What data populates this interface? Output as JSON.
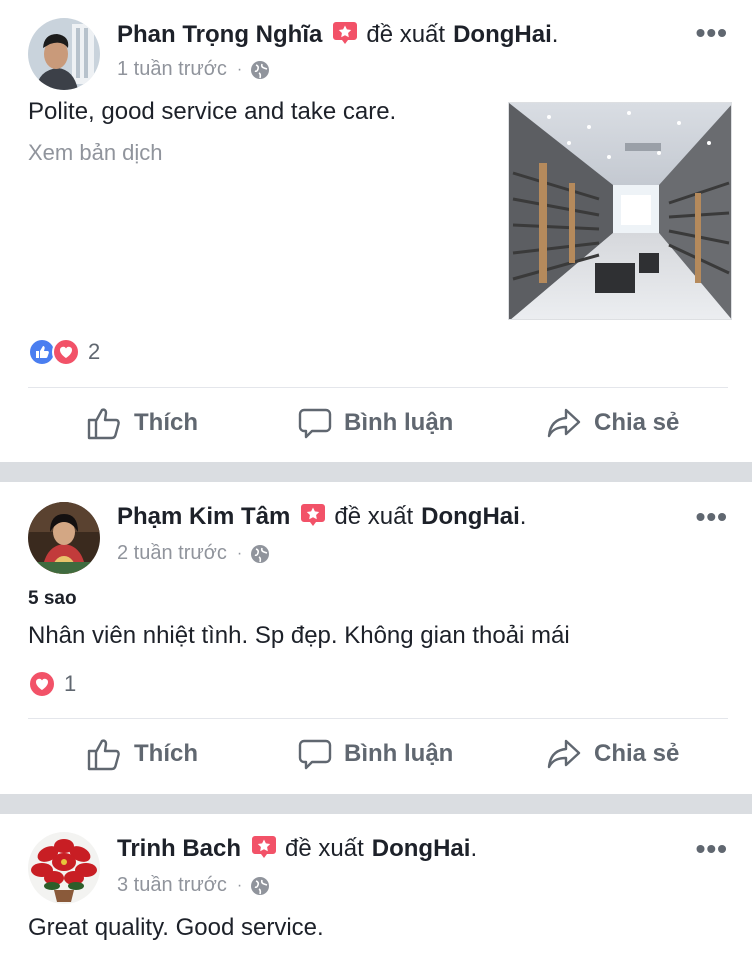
{
  "posts": [
    {
      "author": "Phan Trọng Nghĩa",
      "verb": "đề xuất",
      "page": "DongHai",
      "time": "1 tuần trước",
      "text": "Polite, good service and take care.",
      "translate_link": "Xem bản dịch",
      "reaction_count": "2",
      "reactions": [
        "like-icon",
        "love-icon"
      ]
    },
    {
      "author": "Phạm Kim Tâm",
      "verb": "đề xuất",
      "page": "DongHai",
      "time": "2 tuần trước",
      "rating": "5 sao",
      "text": "Nhân viên nhiệt tình. Sp đẹp. Không gian thoải mái",
      "reaction_count": "1",
      "reactions": [
        "love-icon"
      ]
    },
    {
      "author": "Trinh Bach",
      "verb": "đề xuất",
      "page": "DongHai",
      "time": "3 tuần trước",
      "text": "Great quality. Good service."
    }
  ],
  "actions": {
    "like": "Thích",
    "comment": "Bình luận",
    "share": "Chia sẻ"
  },
  "more_label": "•••",
  "colors": {
    "like_blue": "#4a7ef0",
    "love_red": "#f25268",
    "recommend_badge": "#f25268",
    "meta_gray": "#90949c",
    "separator": "#dadde1"
  }
}
